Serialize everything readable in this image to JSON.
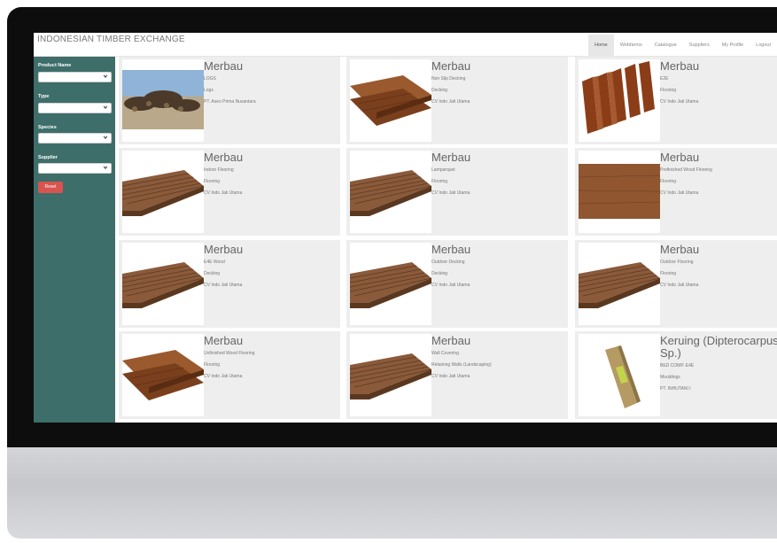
{
  "brand": "INDONESIAN TIMBER EXCHANGE",
  "nav": [
    "Home",
    "Webfarms",
    "Catalogue",
    "Suppliers",
    "My Profile",
    "Logout"
  ],
  "filters": [
    {
      "label": "Product Name",
      "value": ""
    },
    {
      "label": "Type",
      "value": ""
    },
    {
      "label": "Species",
      "value": ""
    },
    {
      "label": "Supplier",
      "value": ""
    }
  ],
  "reset_label": "Reset",
  "colors": {
    "sidebar": "#3d6e6a",
    "reset": "#d9534f"
  },
  "products": [
    {
      "title": "Merbau",
      "product": "LOGS",
      "type": "Logs",
      "supplier": "PT. Aseo Prima Nusantara",
      "image": "logs-pile"
    },
    {
      "title": "Merbau",
      "product": "Non Slip Decking",
      "type": "Decking",
      "supplier": "CV Indo Jati Utama",
      "image": "planks"
    },
    {
      "title": "Merbau",
      "product": "E2E",
      "type": "Flooring",
      "supplier": "CV Indo Jati Utama",
      "image": "boards-stack"
    },
    {
      "title": "Merbau",
      "product": "Indoor Flooring",
      "type": "Flooring",
      "supplier": "CV Indo Jati Utama",
      "image": "grooved-deck"
    },
    {
      "title": "Merbau",
      "product": "Lamparquet",
      "type": "Flooring",
      "supplier": "CV Indo Jati Utama",
      "image": "grooved-deck"
    },
    {
      "title": "Merbau",
      "product": "Prefinished Wood Flooring",
      "type": "Flooring",
      "supplier": "CV Indo Jati Utama",
      "image": "flat-board"
    },
    {
      "title": "Merbau",
      "product": "E4E Wood",
      "type": "Decking",
      "supplier": "CV Indo Jati Utama",
      "image": "grooved-deck"
    },
    {
      "title": "Merbau",
      "product": "Outdoor Decking",
      "type": "Decking",
      "supplier": "CV Indo Jati Utama",
      "image": "grooved-deck"
    },
    {
      "title": "Merbau",
      "product": "Outdoor Flooring",
      "type": "Flooring",
      "supplier": "CV Indo Jati Utama",
      "image": "grooved-deck"
    },
    {
      "title": "Merbau",
      "product": "Unfinished Wood Flooring",
      "type": "Flooring",
      "supplier": "CV Indo Jati Utama",
      "image": "planks"
    },
    {
      "title": "Merbau",
      "product": "Wall Covering",
      "type": "Retaining Walls (Landscaping)",
      "supplier": "CV Indo Jati Utama",
      "image": "grooved-deck"
    },
    {
      "title": "Keruing (Dipterocarpus Sp.)",
      "product": "BED COMP. E4E",
      "type": "Mouldings",
      "supplier": "PT. INHUTANI I",
      "image": "moulding"
    }
  ]
}
